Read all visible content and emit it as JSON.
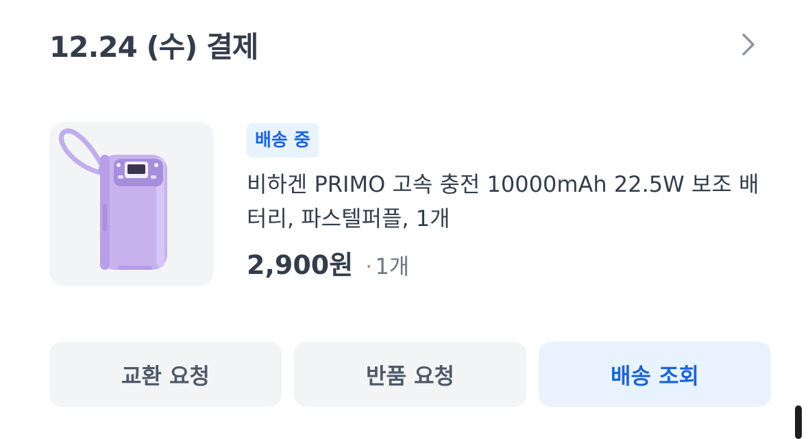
{
  "order": {
    "date_label": "12.24 (수) 결제"
  },
  "product": {
    "status_badge": "배송 중",
    "name": "비하겐 PRIMO 고속 충전 10000mAh 22.5W 보조 배터리, 파스텔퍼플, 1개",
    "price": "2,900원",
    "quantity_dot": "·",
    "quantity": "1개",
    "image_icon": "power-bank-image"
  },
  "actions": {
    "exchange_label": "교환 요청",
    "return_label": "반품 요청",
    "track_label": "배송 조회"
  },
  "colors": {
    "text_primary": "#333d4b",
    "accent_blue": "#1b64da",
    "accent_blue_bg": "#e8f3ff",
    "button_gray_bg": "#f2f4f6",
    "product_purple": "#c7b2ee"
  }
}
